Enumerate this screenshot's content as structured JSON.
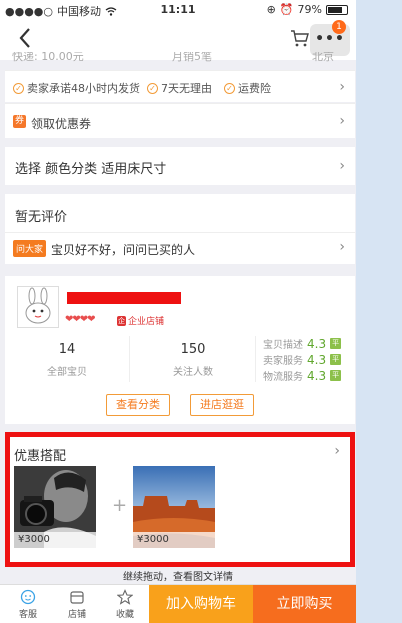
{
  "status_bar": {
    "carrier": "中国移动",
    "time": "11:11",
    "battery": "79%"
  },
  "nav": {
    "more_badge": "1"
  },
  "cut_off_row": {
    "left": "快递: 10.00元",
    "middle": "月销5笔",
    "right": "北京"
  },
  "service_promises": [
    "卖家承诺48小时内发货",
    "7天无理由",
    "运费险"
  ],
  "coupon": {
    "icon": "券",
    "label": "领取优惠券"
  },
  "sku_select": {
    "label": "选择  颜色分类 适用床尺寸"
  },
  "reviews": {
    "title": "暂无评价",
    "ask_badge": "问大家",
    "ask_text": "宝贝好不好，问问已买的人"
  },
  "shop": {
    "hearts": "❤❤❤❤",
    "enterprise_badge": "企",
    "enterprise_label": "企业店铺",
    "stats": [
      {
        "value": "14",
        "label": "全部宝贝"
      },
      {
        "value": "150",
        "label": "关注人数"
      }
    ],
    "scores": [
      {
        "label": "宝贝描述",
        "value": "4.3",
        "tag": "平"
      },
      {
        "label": "卖家服务",
        "value": "4.3",
        "tag": "平"
      },
      {
        "label": "物流服务",
        "value": "4.3",
        "tag": "平"
      }
    ],
    "view_categories": "查看分类",
    "enter_shop": "进店逛逛"
  },
  "bundle": {
    "title": "优惠搭配",
    "items": [
      {
        "price": "¥3000"
      },
      {
        "price": "¥3000"
      }
    ],
    "plus": "+"
  },
  "drag_hint": "继续拖动，查看图文详情",
  "tab_bar": {
    "service": "客服",
    "shop": "店铺",
    "favorite": "收藏",
    "add_to_cart": "加入购物车",
    "buy_now": "立即购买"
  },
  "colors": {
    "accent_orange": "#f66d1e",
    "cart_yellow": "#f9a11b",
    "highlight_red": "#ee1111",
    "score_green": "#61a72e"
  }
}
